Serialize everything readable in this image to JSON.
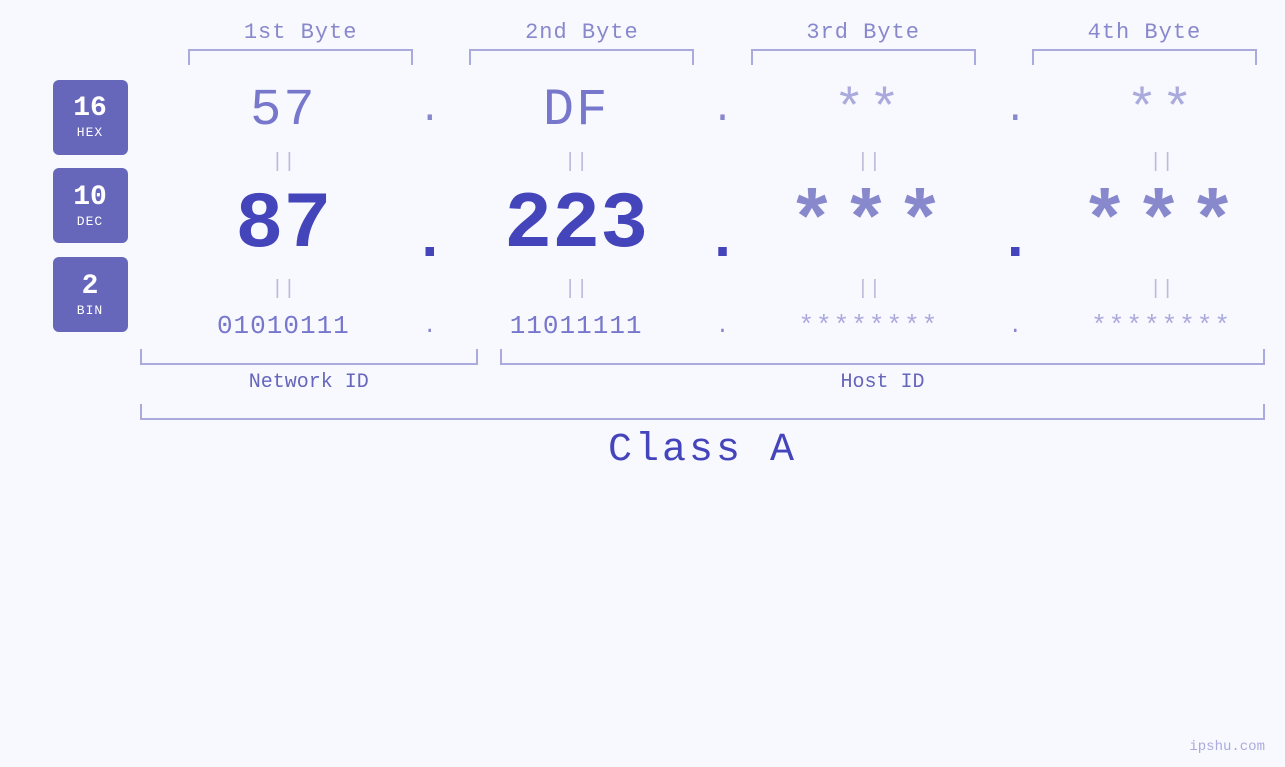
{
  "header": {
    "byte1": "1st Byte",
    "byte2": "2nd Byte",
    "byte3": "3rd Byte",
    "byte4": "4th Byte"
  },
  "badges": [
    {
      "number": "16",
      "label": "HEX"
    },
    {
      "number": "10",
      "label": "DEC"
    },
    {
      "number": "2",
      "label": "BIN"
    }
  ],
  "hex_row": {
    "b1": "57",
    "dot1": ".",
    "b2": "DF",
    "dot2": ".",
    "b3": "**",
    "dot3": ".",
    "b4": "**"
  },
  "dec_row": {
    "b1": "87",
    "dot1": ".",
    "b2": "223",
    "dot2": ".",
    "b3": "***",
    "dot3": ".",
    "b4": "***"
  },
  "bin_row": {
    "b1": "01010111",
    "dot1": ".",
    "b2": "11011111",
    "dot2": ".",
    "b3": "********",
    "dot3": ".",
    "b4": "********"
  },
  "labels": {
    "network_id": "Network ID",
    "host_id": "Host ID",
    "class": "Class A"
  },
  "watermark": "ipshu.com",
  "equals": "||"
}
